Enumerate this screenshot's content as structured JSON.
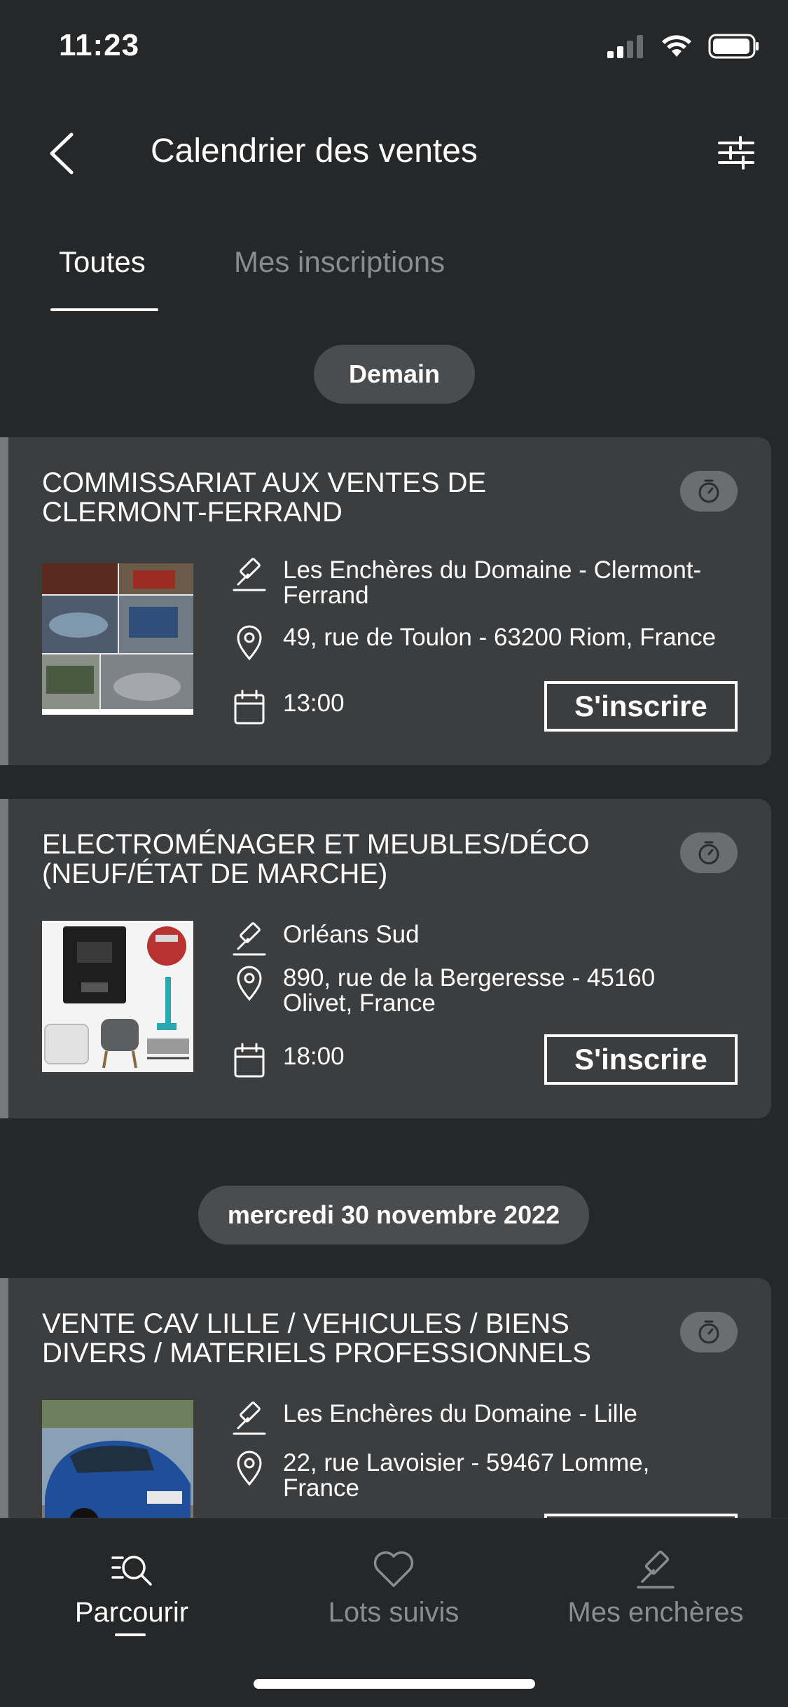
{
  "status": {
    "time": "11:23"
  },
  "header": {
    "title": "Calendrier des ventes"
  },
  "tabs": [
    {
      "label": "Toutes",
      "active": true
    },
    {
      "label": "Mes inscriptions",
      "active": false
    }
  ],
  "groups": [
    {
      "date_label": "Demain"
    },
    {
      "date_label": "mercredi 30 novembre 2022"
    }
  ],
  "sales": [
    {
      "title": "COMMISSARIAT AUX VENTES DE CLERMONT-FERRAND",
      "auctioneer": "Les Enchères du Domaine - Clermont-Ferrand",
      "address": "49, rue de Toulon  - 63200 Riom, France",
      "time": "13:00",
      "register_label": "S'inscrire"
    },
    {
      "title": "ELECTROMÉNAGER ET MEUBLES/DÉCO (NEUF/ÉTAT DE MARCHE)",
      "auctioneer": "Orléans Sud",
      "address": "890, rue de la Bergeresse - 45160 Olivet, France",
      "time": "18:00",
      "register_label": "S'inscrire"
    },
    {
      "title": "VENTE CAV LILLE / VEHICULES / BIENS DIVERS / MATERIELS PROFESSIONNELS",
      "auctioneer": "Les Enchères du Domaine - Lille",
      "address": "22, rue Lavoisier  - 59467 Lomme, France"
    }
  ],
  "bottom_nav": [
    {
      "label": "Parcourir",
      "icon": "search-list-icon",
      "active": true
    },
    {
      "label": "Lots suivis",
      "icon": "heart-icon",
      "active": false
    },
    {
      "label": "Mes enchères",
      "icon": "gavel-icon",
      "active": false
    }
  ],
  "colors": {
    "background": "#252728",
    "card": "#3b3d3f",
    "pill": "#4a4c4e",
    "muted_text": "#8a8c8e"
  }
}
